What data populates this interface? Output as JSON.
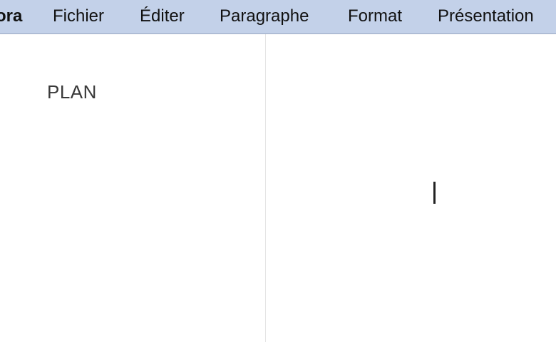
{
  "menubar": {
    "app_name": "ora",
    "items": [
      {
        "label": "Fichier"
      },
      {
        "label": "Éditer"
      },
      {
        "label": "Paragraphe"
      },
      {
        "label": "Format"
      },
      {
        "label": "Présentation"
      }
    ]
  },
  "sidebar": {
    "title": "PLAN"
  },
  "colors": {
    "menubar_bg": "#c3d1e9",
    "divider": "#e4e4e4",
    "caret": "#222222"
  }
}
